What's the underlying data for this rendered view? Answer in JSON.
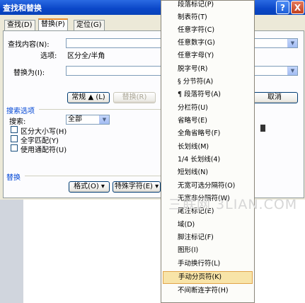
{
  "dialog": {
    "title": "查找和替换",
    "help_label": "?",
    "close_label": "X",
    "tabs": [
      {
        "label": "查找(D)"
      },
      {
        "label": "替换(P)"
      },
      {
        "label": "定位(G)"
      }
    ],
    "find_label": "查找内容(N):",
    "options_label": "选项:",
    "options_value": "区分全/半角",
    "replace_label": "替换为(I):",
    "buttons": {
      "normal": "常规 ▲ (L)",
      "replace": "替换(R)",
      "cancel": "取消",
      "format": "格式(O) ▾",
      "special": "特殊字符(E) ▾"
    },
    "search_options_label": "搜索选项",
    "search_label": "搜索:",
    "search_value": "全部",
    "checkboxes": [
      {
        "label": "区分大小写(H)"
      },
      {
        "label": "全字匹配(Y)"
      },
      {
        "label": "使用通配符(U)"
      }
    ],
    "replace_section_label": "替换"
  },
  "special_menu": {
    "items": [
      {
        "label": "段落标记(P)"
      },
      {
        "label": "制表符(T)"
      },
      {
        "label": "任意字符(C)"
      },
      {
        "label": "任意数字(G)"
      },
      {
        "label": "任意字母(Y)"
      },
      {
        "label": "脱字号(R)"
      },
      {
        "label": "§ 分节符(A)"
      },
      {
        "label": "¶ 段落符号(A)"
      },
      {
        "label": "分栏符(U)"
      },
      {
        "label": "省略号(E)"
      },
      {
        "label": "全角省略号(F)"
      },
      {
        "label": "长划线(M)"
      },
      {
        "label": "1/4 长划线(4)"
      },
      {
        "label": "短划线(N)"
      },
      {
        "label": "无宽可选分隔符(O)"
      },
      {
        "label": "无宽非分隔符(W)"
      },
      {
        "label": "尾注标记(E)"
      },
      {
        "label": "域(D)"
      },
      {
        "label": "脚注标记(F)"
      },
      {
        "label": "图形(I)"
      },
      {
        "label": "手动换行符(L)"
      },
      {
        "label": "手动分页符(K)"
      },
      {
        "label": "不间断连字符(H)"
      }
    ],
    "highlighted_index": 21
  },
  "watermark_text": "三联网 3LIAN.COM"
}
